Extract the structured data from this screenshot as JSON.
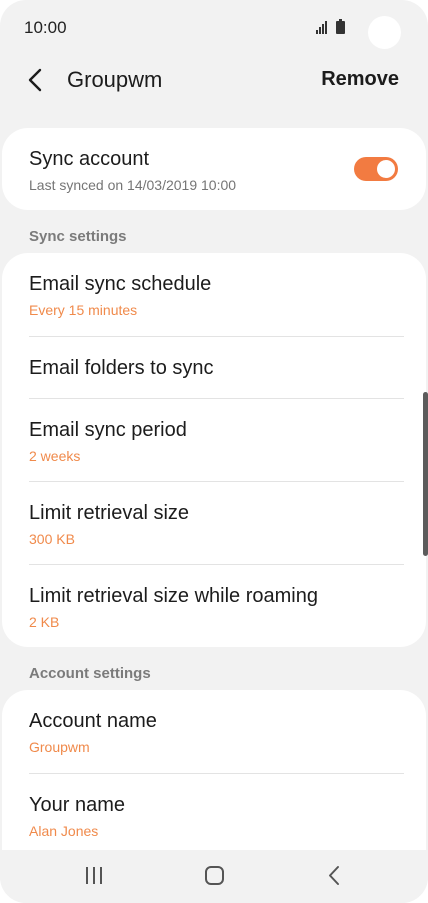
{
  "status_bar": {
    "time": "10:00"
  },
  "header": {
    "title": "Groupwm",
    "remove_label": "Remove"
  },
  "sync_account": {
    "title": "Sync account",
    "subtitle": "Last synced on 14/03/2019  10:00",
    "enabled": true
  },
  "sync_settings": {
    "label": "Sync settings",
    "items": [
      {
        "title": "Email sync schedule",
        "value": "Every 15 minutes"
      },
      {
        "title": "Email folders to sync"
      },
      {
        "title": "Email sync period",
        "value": "2 weeks"
      },
      {
        "title": "Limit retrieval size",
        "value": "300 KB"
      },
      {
        "title": "Limit retrieval size while roaming",
        "value": "2 KB"
      }
    ]
  },
  "account_settings": {
    "label": "Account settings",
    "items": [
      {
        "title": "Account name",
        "value": "Groupwm"
      },
      {
        "title": "Your name",
        "value": "Alan Jones"
      }
    ]
  },
  "icons": {
    "back": "chevron-left-icon",
    "signal": "signal-icon",
    "battery": "battery-icon",
    "nav_recent": "recent-apps-icon",
    "nav_home": "home-icon",
    "nav_back": "back-icon"
  },
  "colors": {
    "accent": "#f27b41",
    "value_text": "#f08a4b",
    "background": "#f2f2f2"
  }
}
